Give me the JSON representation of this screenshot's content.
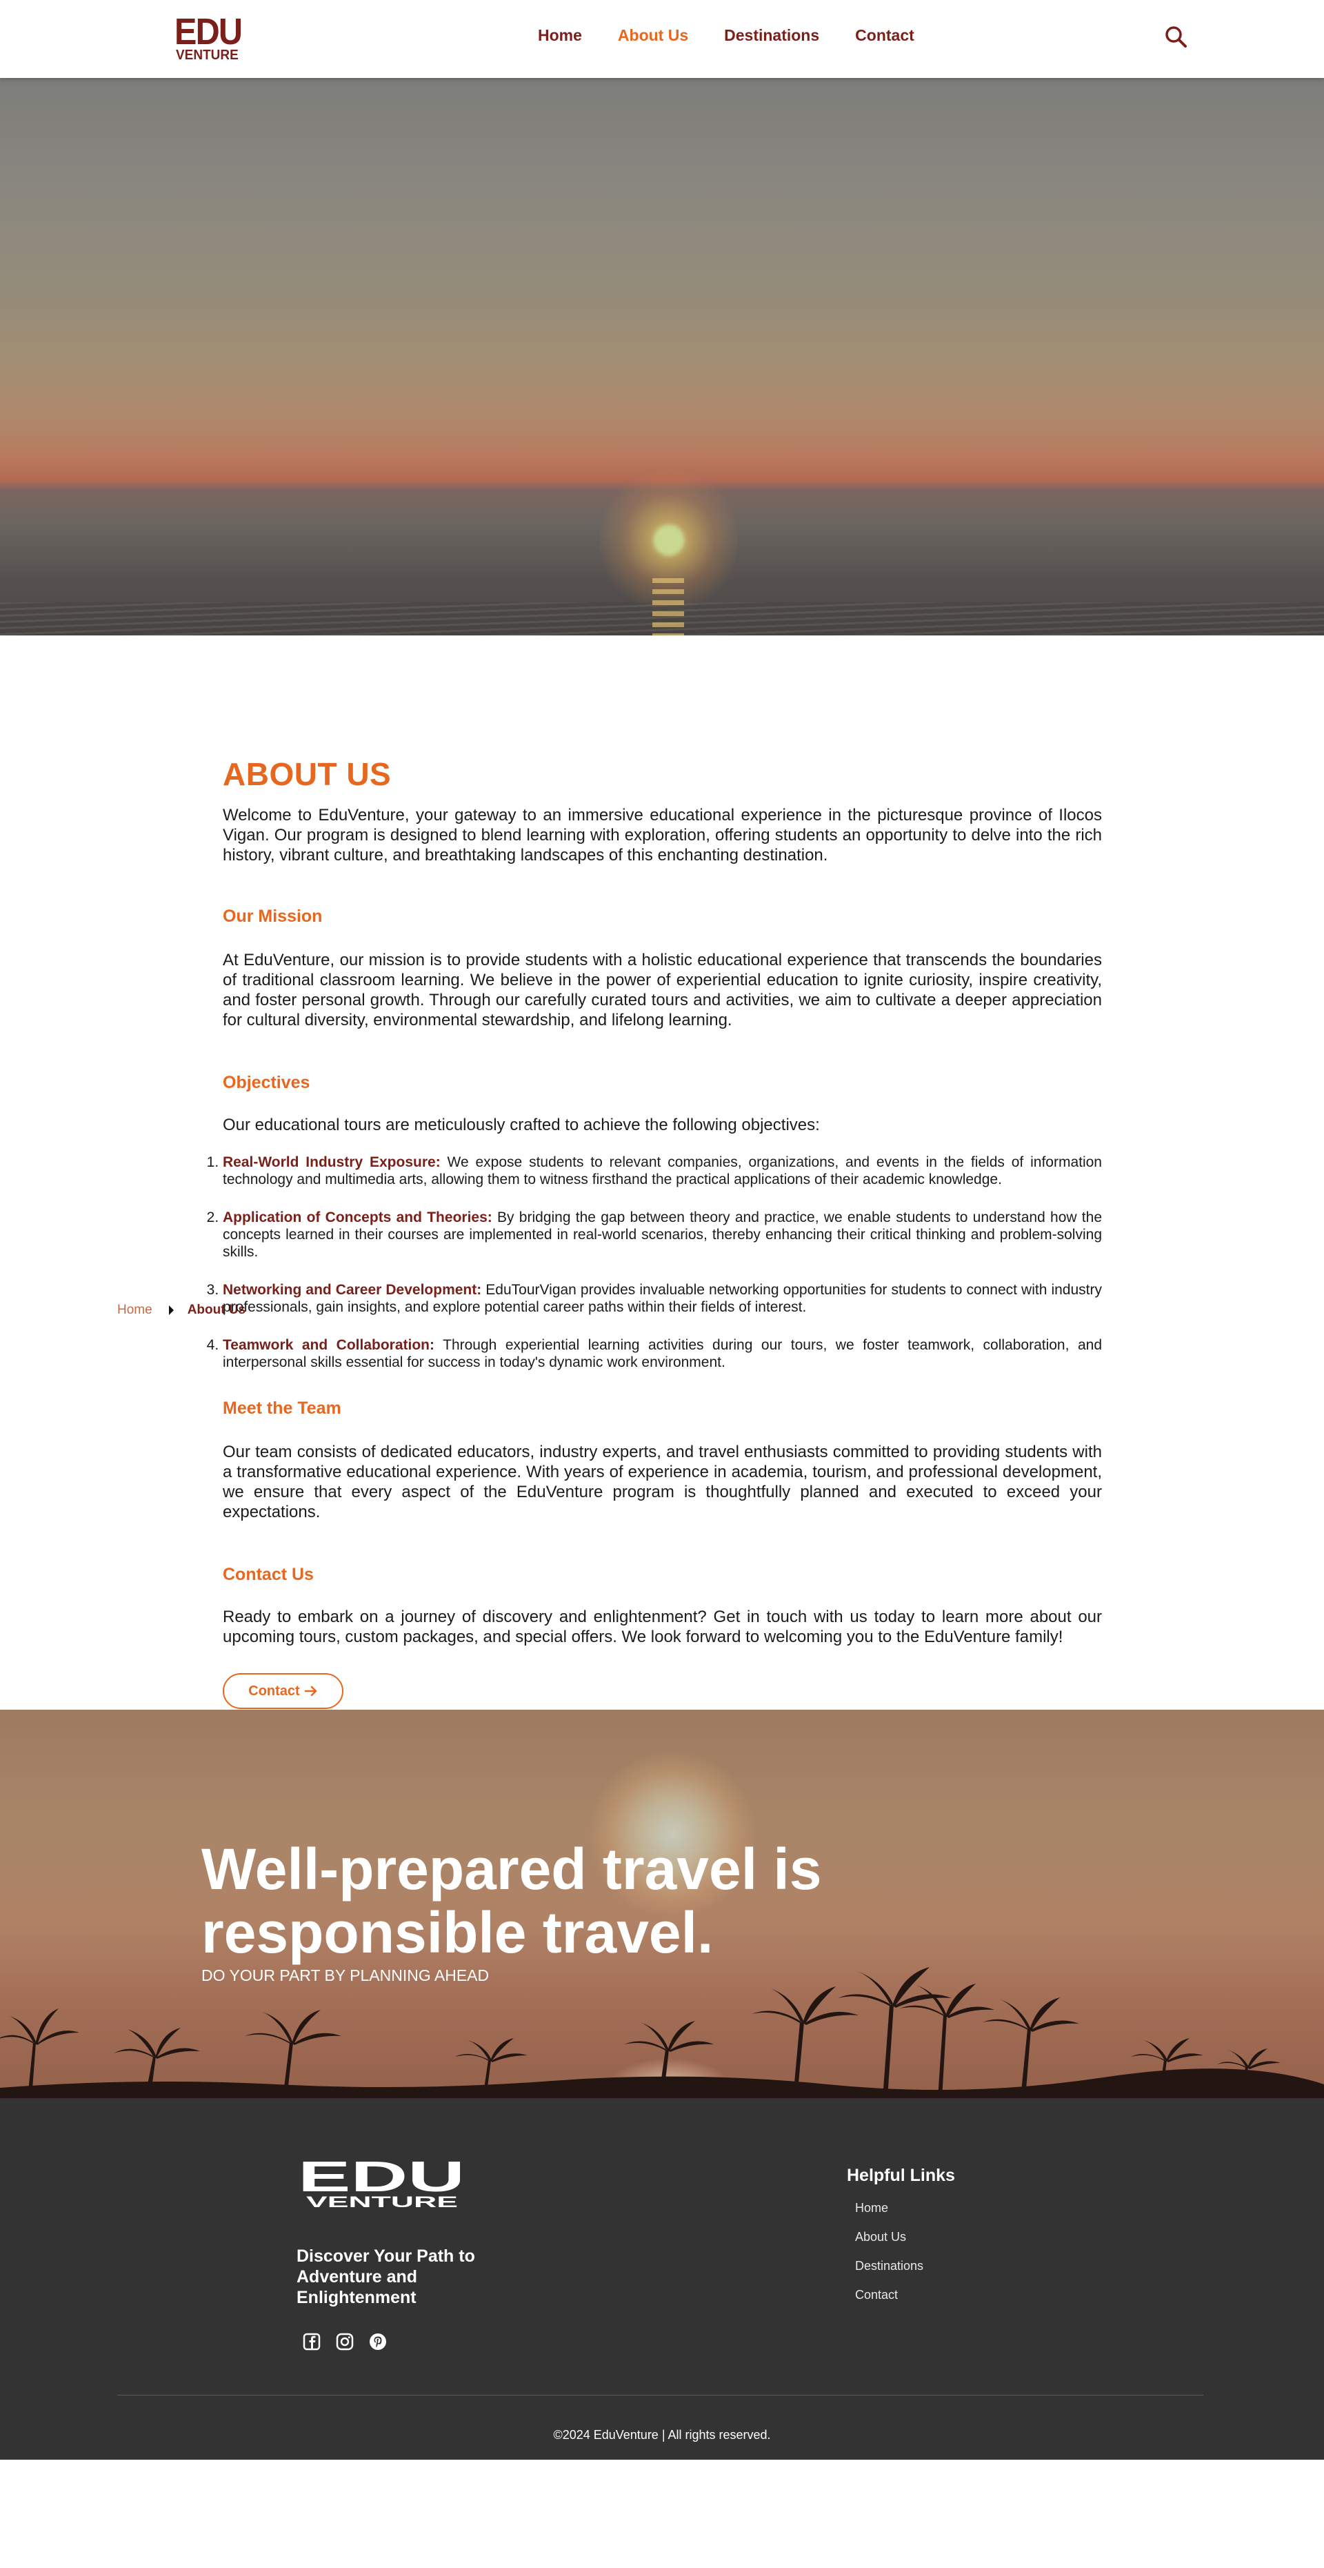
{
  "header": {
    "logo": {
      "top": "EDU",
      "bottom": "VENTURE"
    },
    "nav": [
      {
        "label": "Home"
      },
      {
        "label": "About Us"
      },
      {
        "label": "Destinations"
      },
      {
        "label": "Contact"
      }
    ],
    "active_nav": "About Us",
    "search_icon": "search-icon"
  },
  "breadcrumb": {
    "home": "Home",
    "current": "About Us"
  },
  "about": {
    "title": "ABOUT US",
    "intro": "Welcome to EduVenture, your gateway to an immersive educational experience in the picturesque province of Ilocos Vigan. Our program is designed to blend learning with exploration, offering students an opportunity to delve into the rich history, vibrant culture, and breathtaking landscapes of this enchanting destination.",
    "mission": {
      "title": "Our Mission",
      "body": "At EduVenture, our mission is to provide students with a holistic educational experience that transcends the boundaries of traditional classroom learning. We believe in the power of experiential education to ignite curiosity, inspire creativity, and foster personal growth. Through our carefully curated tours and activities, we aim to cultivate a deeper appreciation for cultural diversity, environmental stewardship, and lifelong learning."
    },
    "objectives": {
      "title": "Objectives",
      "intro": "Our educational tours are meticulously crafted to achieve the following objectives:",
      "items": [
        {
          "strong": "Real-World Industry Exposure:",
          "text": " We expose students to relevant companies, organizations, and events in the fields of information technology and multimedia arts, allowing them to witness firsthand the practical applications of their academic knowledge."
        },
        {
          "strong": "Application of Concepts and Theories:",
          "text": " By bridging the gap between theory and practice, we enable students to understand how the concepts learned in their courses are implemented in real-world scenarios, thereby enhancing their critical thinking and problem-solving skills."
        },
        {
          "strong": "Networking and Career Development:",
          "text": " EduTourVigan provides invaluable networking opportunities for students to connect with industry professionals, gain insights, and explore potential career paths within their fields of interest."
        },
        {
          "strong": "Teamwork and Collaboration:",
          "text": " Through experiential learning activities during our tours, we foster teamwork, collaboration, and interpersonal skills essential for success in today's dynamic work environment."
        }
      ]
    },
    "team": {
      "title": "Meet the Team",
      "body": "Our team consists of dedicated educators, industry experts, and travel enthusiasts committed to providing students with a transformative educational experience. With years of experience in academia, tourism, and professional development, we ensure that every aspect of the EduVenture program is thoughtfully planned and executed to exceed your expectations."
    },
    "contact": {
      "title": "Contact Us",
      "body": "Ready to embark on a journey of discovery and enlightenment? Get in touch with us today to learn more about our upcoming tours, custom packages, and special offers. We look forward to welcoming you to the EduVenture family!",
      "button_label": "Contact",
      "button_icon": "arrow-right-icon"
    }
  },
  "banner": {
    "title": "Well-prepared travel is responsible travel.",
    "subtitle": "DO YOUR PART BY PLANNING AHEAD"
  },
  "footer": {
    "logo": {
      "top": "EDU",
      "bottom": "VENTURE"
    },
    "tagline": "Discover Your Path to Adventure and Enlightenment",
    "social": [
      "facebook-icon",
      "instagram-icon",
      "pinterest-icon"
    ],
    "links_title": "Helpful Links",
    "links": [
      {
        "label": "Home"
      },
      {
        "label": "About Us"
      },
      {
        "label": "Destinations"
      },
      {
        "label": "Contact"
      }
    ],
    "copyright": "©2024 EduVenture | All rights reserved."
  },
  "colors": {
    "brand_maroon": "#7a1f1a",
    "accent_orange": "#e8671f",
    "footer_bg": "#333333"
  }
}
